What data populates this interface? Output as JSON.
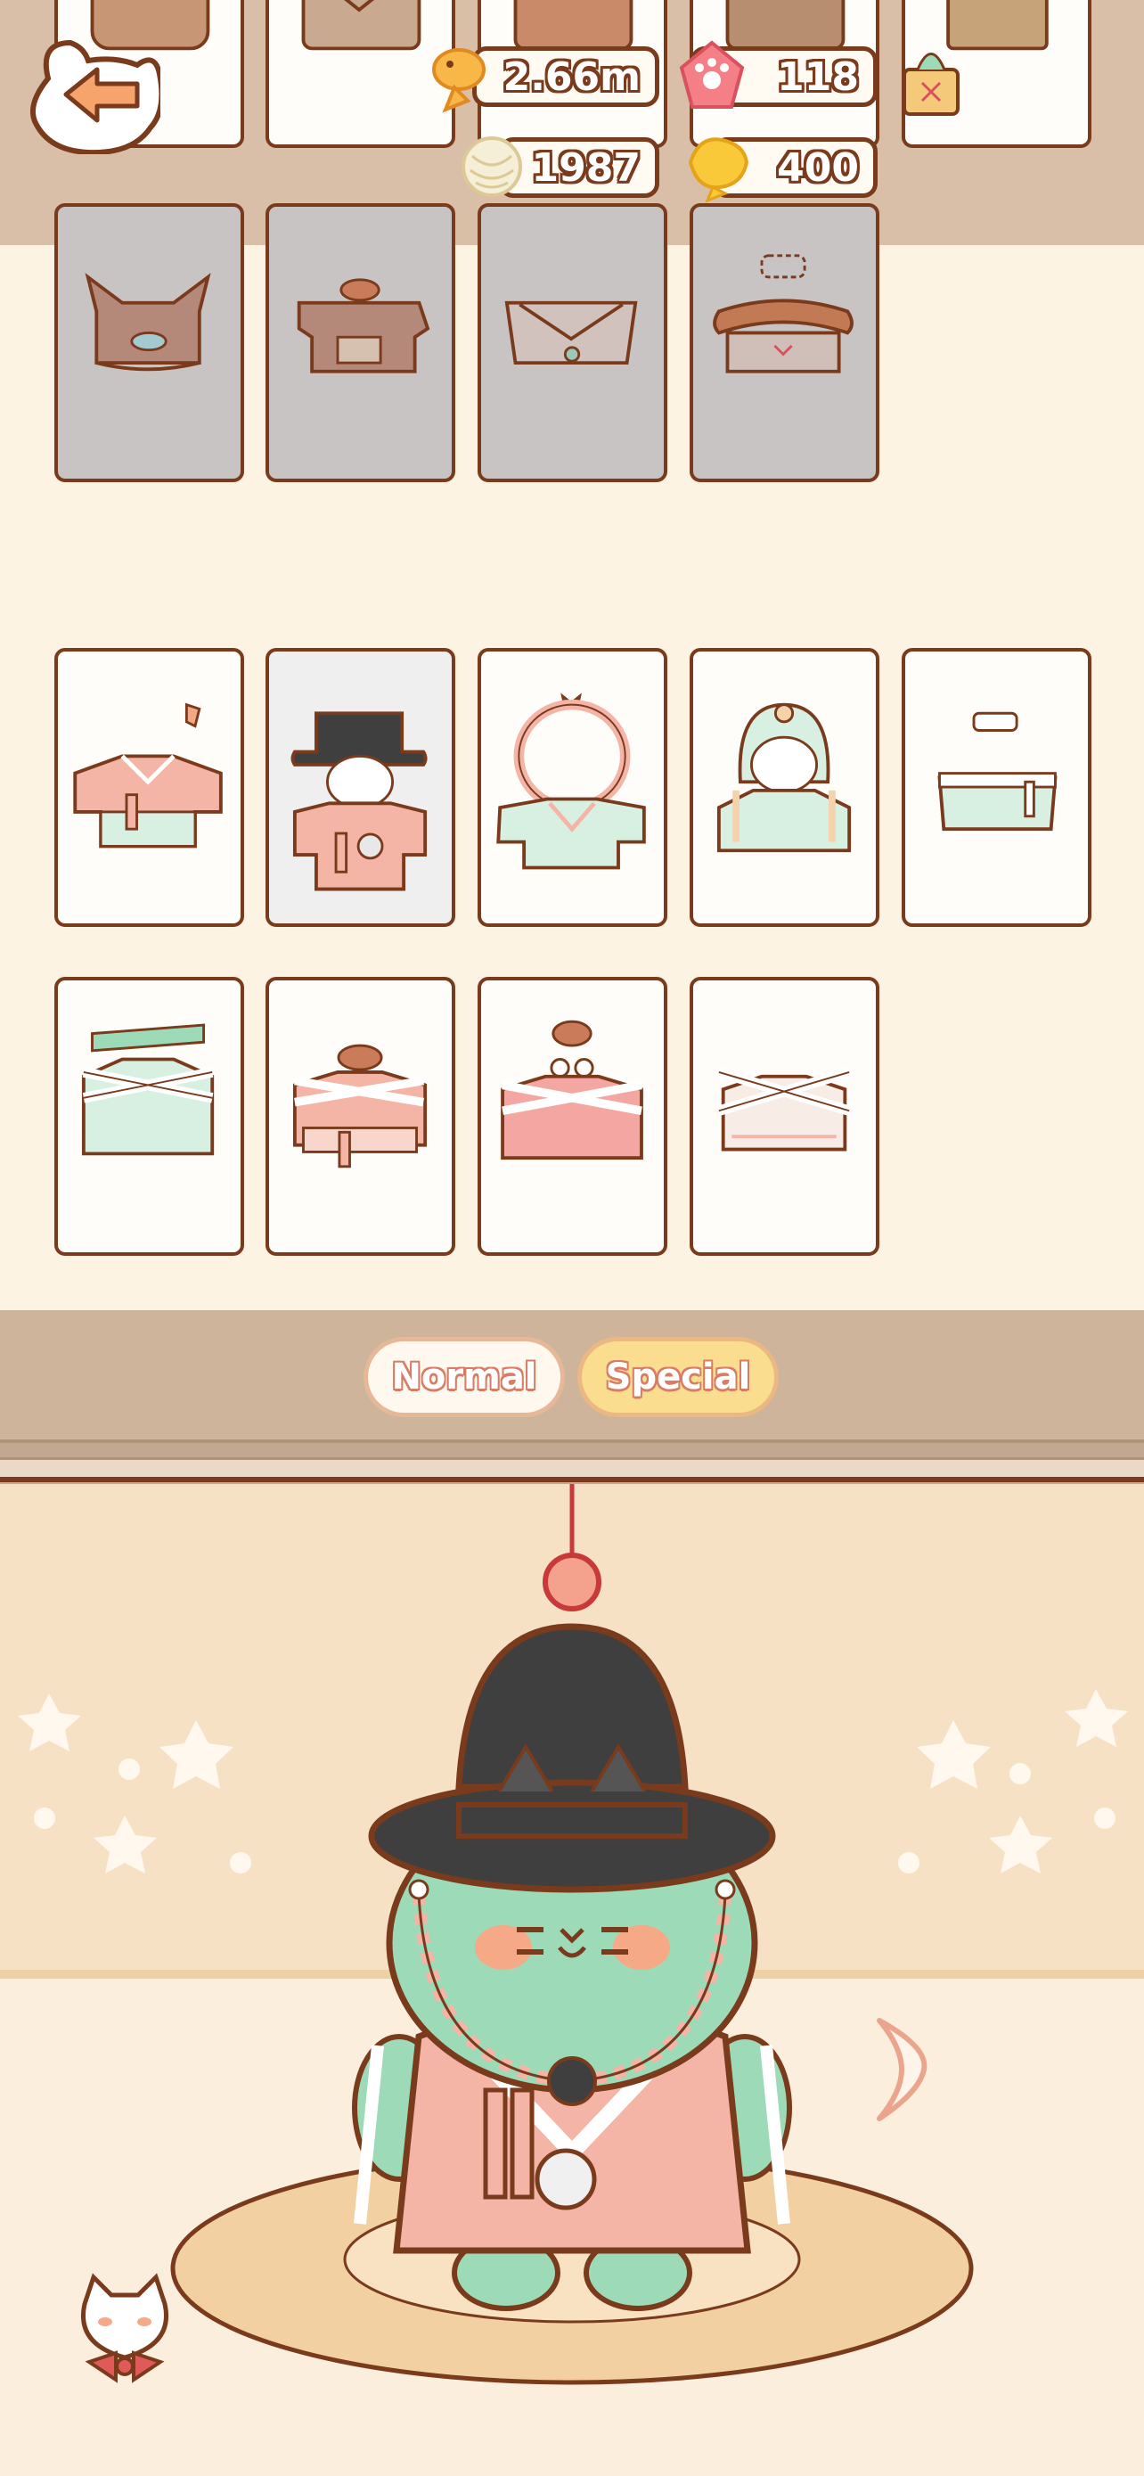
{
  "header": {
    "currencies": {
      "fish": "2.66m",
      "paw_gem": "118",
      "yarn": "1987",
      "gold": "400"
    }
  },
  "wardrobe": {
    "row_top_partial": [
      "hooded-coat",
      "collar-coat",
      "bow-coat",
      "round-coat",
      "shopping-bag"
    ],
    "row_locked": [
      "ear-hat-outfit",
      "fur-beret-outfit",
      "collar-vest",
      "sausage-outfit"
    ],
    "row_1": [
      "hanbok-crane",
      "hanbok-gat",
      "hanbok-bow",
      "hanbok-hood",
      "hanbok-band"
    ],
    "row_2": [
      "hanbok-mint",
      "hanbok-beret",
      "hanbok-glasses",
      "hanbok-cream"
    ]
  },
  "tabs": {
    "normal": "Normal",
    "special": "Special"
  },
  "colors": {
    "outline": "#7a3a1c",
    "card_bg": "#fffdf9",
    "locked_bg": "#c9c4c4",
    "tabbar": "#ceb49a",
    "special_tab": "#fbdd90",
    "cat_body": "#9ddbb8",
    "hanbok_pink": "#f4b4a6"
  }
}
